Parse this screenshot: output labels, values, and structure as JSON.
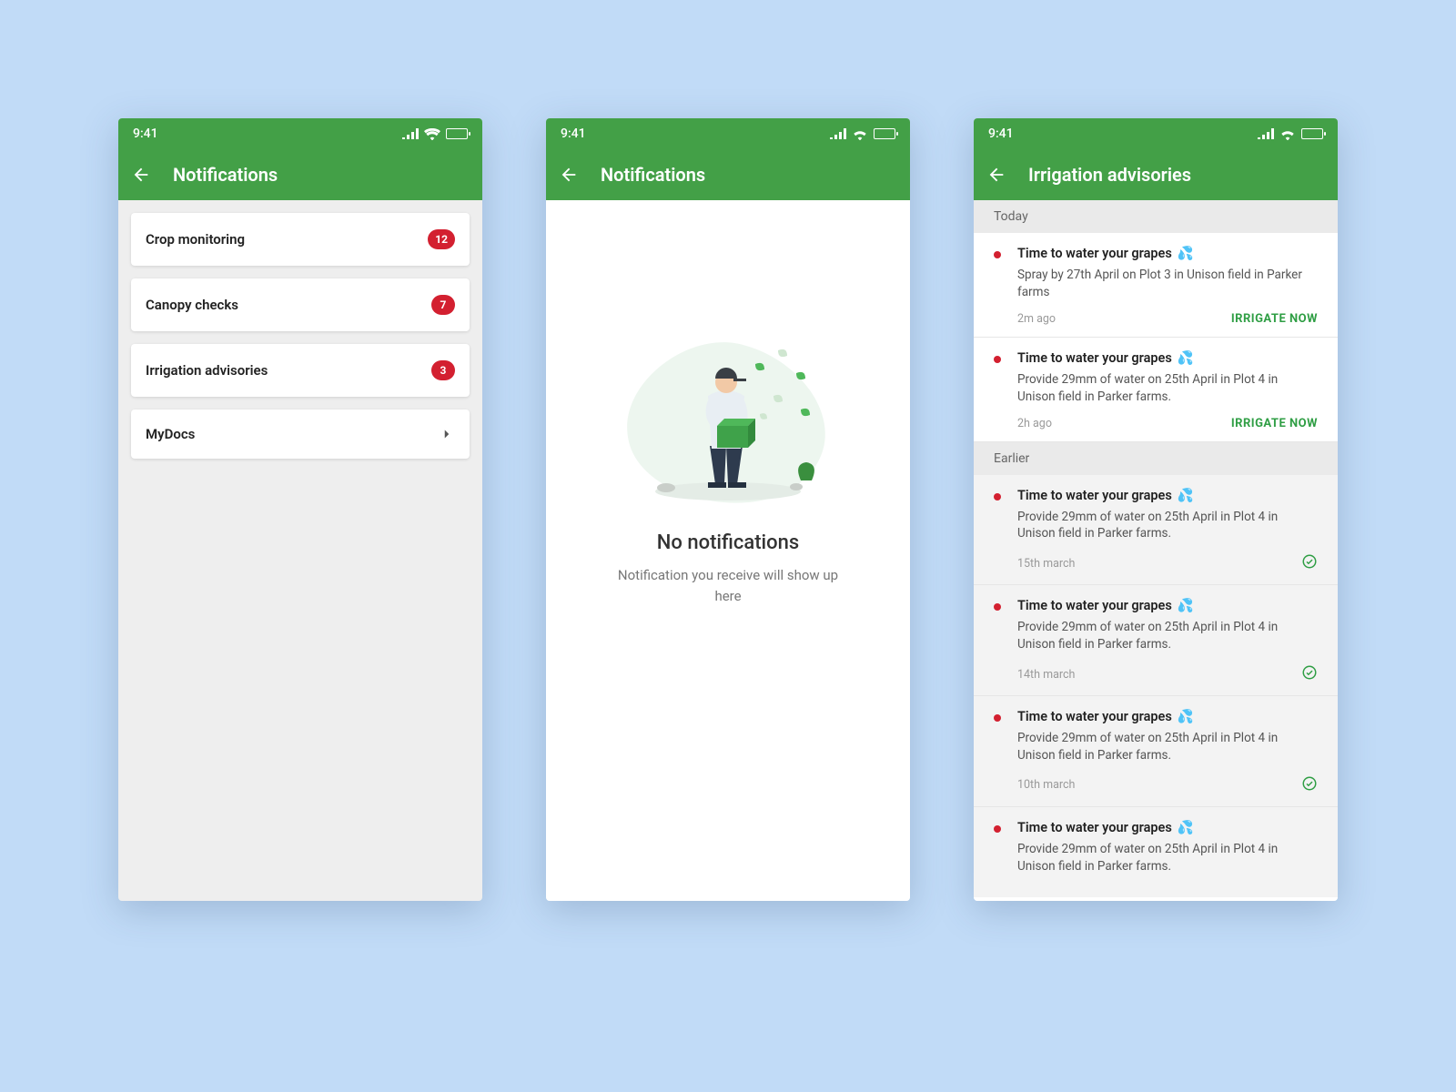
{
  "status": {
    "time": "9:41"
  },
  "colors": {
    "primary": "#43a047",
    "badge": "#d32030",
    "action": "#2f9e44"
  },
  "screen1": {
    "title": "Notifications",
    "items": [
      {
        "label": "Crop monitoring",
        "badge": "12"
      },
      {
        "label": "Canopy checks",
        "badge": "7"
      },
      {
        "label": "Irrigation advisories",
        "badge": "3"
      },
      {
        "label": "MyDocs"
      }
    ]
  },
  "screen2": {
    "title": "Notifications",
    "empty_title": "No notifications",
    "empty_subtitle": "Notification you receive will show up here"
  },
  "screen3": {
    "title": "Irrigation advisories",
    "sections": {
      "today": {
        "label": "Today",
        "items": [
          {
            "title": "Time to water your grapes",
            "desc": "Spray by 27th April on Plot 3 in Unison field in Parker farms",
            "time": "2m ago",
            "action": "IRRIGATE NOW"
          },
          {
            "title": "Time to water your grapes",
            "desc": "Provide 29mm of water on 25th April in Plot 4 in Unison field in Parker farms.",
            "time": "2h ago",
            "action": "IRRIGATE NOW"
          }
        ]
      },
      "earlier": {
        "label": "Earlier",
        "items": [
          {
            "title": "Time to water your grapes",
            "desc": "Provide 29mm of water on 25th April in Plot 4 in Unison field in Parker farms.",
            "time": "15th march"
          },
          {
            "title": "Time to water your grapes",
            "desc": "Provide 29mm of water on 25th April in Plot 4 in Unison field in Parker farms.",
            "time": "14th march"
          },
          {
            "title": "Time to water your grapes",
            "desc": "Provide 29mm of water on 25th April in Plot 4 in Unison field in Parker farms.",
            "time": "10th march"
          },
          {
            "title": "Time to water your grapes",
            "desc": "Provide 29mm of water on 25th April in Plot 4 in Unison field in Parker farms.",
            "time": ""
          }
        ]
      }
    }
  }
}
